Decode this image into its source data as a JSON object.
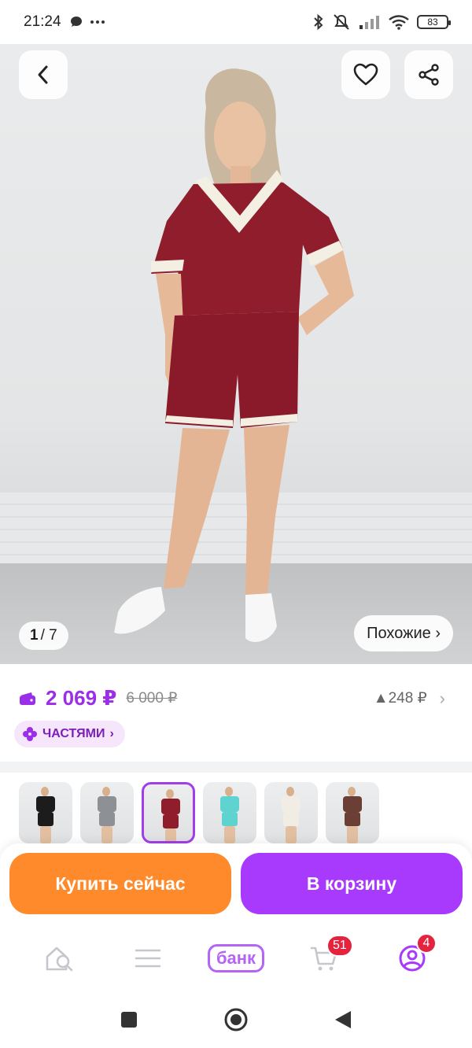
{
  "status_bar": {
    "time": "21:24",
    "left_icons": [
      "chat-bubble-icon",
      "more-dots-icon"
    ],
    "right_icons": [
      "bluetooth-icon",
      "mute-icon",
      "signal-icon",
      "wifi-icon"
    ],
    "battery": "83"
  },
  "product": {
    "image_counter_current": "1",
    "image_counter_total": "/ 7",
    "similar_label": "Похожие ›",
    "price": "2 069 ₽",
    "old_price": "6 000 ₽",
    "bonus": "▲248 ₽",
    "installments_label": "ЧАСТЯМИ",
    "variants": [
      {
        "color": "black",
        "top": "#1c1c1c",
        "bottom": "#1c1c1c"
      },
      {
        "color": "gray",
        "top": "#8d9196",
        "bottom": "#8d9196"
      },
      {
        "color": "burgundy",
        "top": "#8f1d2c",
        "bottom": "#8f1d2c",
        "selected": true
      },
      {
        "color": "turquoise",
        "top": "#5fd3cf",
        "bottom": "#5fd3cf"
      },
      {
        "color": "cream",
        "top": "#f1ede4",
        "bottom": "#f1ede4"
      },
      {
        "color": "brown",
        "top": "#6b3f35",
        "bottom": "#6b3f35"
      }
    ]
  },
  "actions": {
    "buy_now": "Купить сейчас",
    "add_to_cart": "В корзину"
  },
  "bottom_nav": {
    "items": [
      {
        "name": "home-search",
        "icon": "home-search-icon"
      },
      {
        "name": "catalog",
        "icon": "menu-lines-icon"
      },
      {
        "name": "bank",
        "label": "банк"
      },
      {
        "name": "cart",
        "icon": "cart-icon",
        "badge": "51"
      },
      {
        "name": "profile",
        "icon": "profile-icon",
        "badge": "4"
      }
    ]
  },
  "colors": {
    "accent_purple": "#a73afd",
    "price_purple": "#9b2ee8",
    "buy_orange": "#ff8a2b",
    "badge_red": "#e4233f"
  }
}
